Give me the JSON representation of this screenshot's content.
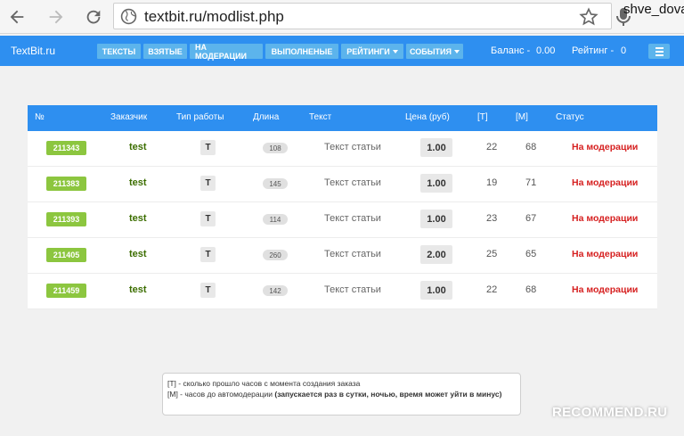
{
  "browser": {
    "url": "textbit.ru/modlist.php",
    "user": "shve_dova"
  },
  "site": {
    "brand": "TextBit.ru",
    "menu": [
      {
        "label": "ТЕКСТЫ",
        "dropdown": false
      },
      {
        "label": "ВЗЯТЫЕ",
        "dropdown": false
      },
      {
        "label": "НА МОДЕРАЦИИ",
        "dropdown": false
      },
      {
        "label": "ВЫПОЛНЕНЫЕ",
        "dropdown": false
      },
      {
        "label": "РЕЙТИНГИ",
        "dropdown": true
      },
      {
        "label": "СОБЫТИЯ",
        "dropdown": true
      }
    ],
    "balance_label": "Баланс -",
    "balance_value": "0.00",
    "rating_label": "Рейтинг -",
    "rating_value": "0"
  },
  "table": {
    "headers": [
      "№",
      "Заказчик",
      "Тип работы",
      "Длина",
      "Текст",
      "Цена (руб)",
      "[T]",
      "[M]",
      "Статус"
    ],
    "rows": [
      {
        "id": "211343",
        "customer": "test",
        "type": "T",
        "length": "108",
        "text": "Текст статьи",
        "price": "1.00",
        "t": "22",
        "m": "68",
        "status": "На модерации"
      },
      {
        "id": "211383",
        "customer": "test",
        "type": "T",
        "length": "145",
        "text": "Текст статьи",
        "price": "1.00",
        "t": "19",
        "m": "71",
        "status": "На модерации"
      },
      {
        "id": "211393",
        "customer": "test",
        "type": "T",
        "length": "114",
        "text": "Текст статьи",
        "price": "1.00",
        "t": "23",
        "m": "67",
        "status": "На модерации"
      },
      {
        "id": "211405",
        "customer": "test",
        "type": "T",
        "length": "260",
        "text": "Текст статьи",
        "price": "2.00",
        "t": "25",
        "m": "65",
        "status": "На модерации"
      },
      {
        "id": "211459",
        "customer": "test",
        "type": "T",
        "length": "142",
        "text": "Текст статьи",
        "price": "1.00",
        "t": "22",
        "m": "68",
        "status": "На модерации"
      }
    ]
  },
  "info": {
    "line1": "[T] - сколько прошло часов с момента создания заказа",
    "line2_plain": "[M] - часов до автомодерации ",
    "line2_bold": "(запускается раз в сутки, ночью, время может уйти в минус)"
  },
  "watermark": "RECOMMEND.RU",
  "colors": {
    "nav_blue": "#2e8ff0",
    "menu_button": "#5cb4ec",
    "id_badge_green": "#8cc63f",
    "status_red": "#d62020",
    "customer_green": "#3c6e00"
  }
}
